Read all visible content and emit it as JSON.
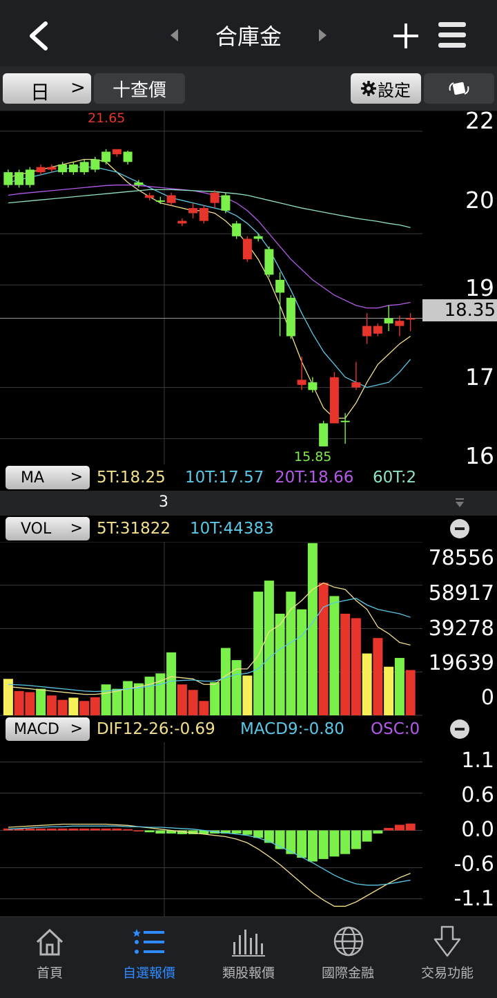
{
  "header": {
    "title": "合庫金",
    "back_icon": "chevron-left-icon",
    "prev_icon": "triangle-left-icon",
    "next_icon": "triangle-right-icon",
    "add_icon": "plus-icon",
    "menu_icon": "hamburger-icon"
  },
  "toolbar": {
    "period_label": "日",
    "period_arrow": ">",
    "query_label": "十查價",
    "settings_label": "設定",
    "settings_icon": "gear-icon",
    "rotate_icon": "rotate-screen-icon"
  },
  "price_chart": {
    "y_ticks": [
      "22",
      "20",
      "19",
      "17",
      "16"
    ],
    "current_price": "18.35",
    "high_label": "21.65",
    "low_label": "15.85",
    "colors": {
      "up": "#e8352b",
      "down": "#7cf04a",
      "ma5": "#f2e08a",
      "ma10": "#5bc8e8",
      "ma20": "#b45ae8",
      "ma60": "#8fe3c0",
      "ma120": "#e86a6a"
    }
  },
  "ma_bar": {
    "label": "MA",
    "ma5": "5T:18.25",
    "ma10": "10T:17.57",
    "ma20": "20T:18.66",
    "ma60": "60T:2"
  },
  "divider": {
    "label": "3"
  },
  "vol_bar": {
    "label": "VOL",
    "ma5": "5T:31822",
    "ma10": "10T:44383"
  },
  "vol_chart": {
    "y_ticks": [
      "78556",
      "58917",
      "39278",
      "19639",
      "0"
    ]
  },
  "macd_bar": {
    "label": "MACD",
    "dif": "DIF12-26:-0.69",
    "macd": "MACD9:-0.80",
    "osc": "OSC:0"
  },
  "macd_chart": {
    "y_ticks": [
      "1.1",
      "0.6",
      "0.0",
      "-0.6",
      "-1.1"
    ]
  },
  "nav": [
    {
      "label": "首頁",
      "icon": "home-icon",
      "active": false
    },
    {
      "label": "自選報價",
      "icon": "list-star-icon",
      "active": true
    },
    {
      "label": "類股報價",
      "icon": "bar-chart-icon",
      "active": false
    },
    {
      "label": "國際金融",
      "icon": "globe-icon",
      "active": false
    },
    {
      "label": "交易功能",
      "icon": "arrow-down-box-icon",
      "active": false
    }
  ],
  "chart_data": [
    {
      "type": "candlestick",
      "title": "合庫金",
      "y_axis_ticks": [
        22,
        20,
        19,
        17,
        16
      ],
      "ylim": [
        15.7,
        22.2
      ],
      "current_price": 18.35,
      "candles": [
        {
          "o": 21.2,
          "c": 20.95,
          "h": 21.25,
          "l": 20.9
        },
        {
          "o": 21.2,
          "c": 20.95,
          "h": 21.25,
          "l": 20.9
        },
        {
          "o": 21.25,
          "c": 20.95,
          "h": 21.3,
          "l": 20.9
        },
        {
          "o": 21.2,
          "c": 21.3,
          "h": 21.35,
          "l": 21.15
        },
        {
          "o": 21.25,
          "c": 21.3,
          "h": 21.35,
          "l": 21.2
        },
        {
          "o": 21.35,
          "c": 21.2,
          "h": 21.4,
          "l": 21.15
        },
        {
          "o": 21.35,
          "c": 21.2,
          "h": 21.4,
          "l": 21.15
        },
        {
          "o": 21.4,
          "c": 21.2,
          "h": 21.45,
          "l": 21.15
        },
        {
          "o": 21.45,
          "c": 21.25,
          "h": 21.5,
          "l": 21.2
        },
        {
          "o": 21.6,
          "c": 21.4,
          "h": 21.65,
          "l": 21.35
        },
        {
          "o": 21.55,
          "c": 21.65,
          "h": 21.65,
          "l": 21.5
        },
        {
          "o": 21.6,
          "c": 21.4,
          "h": 21.62,
          "l": 21.35
        },
        {
          "o": 21.0,
          "c": 20.95,
          "h": 21.05,
          "l": 20.9
        },
        {
          "o": 20.7,
          "c": 20.75,
          "h": 20.8,
          "l": 20.65
        },
        {
          "o": 20.65,
          "c": 20.63,
          "h": 20.72,
          "l": 20.58
        },
        {
          "o": 20.6,
          "c": 20.75,
          "h": 20.8,
          "l": 20.55
        },
        {
          "o": 20.2,
          "c": 20.25,
          "h": 20.3,
          "l": 20.15
        },
        {
          "o": 20.4,
          "c": 20.5,
          "h": 20.6,
          "l": 20.3
        },
        {
          "o": 20.25,
          "c": 20.5,
          "h": 20.55,
          "l": 20.2
        },
        {
          "o": 20.6,
          "c": 20.8,
          "h": 20.85,
          "l": 20.5
        },
        {
          "o": 20.75,
          "c": 20.45,
          "h": 20.8,
          "l": 20.4
        },
        {
          "o": 20.2,
          "c": 19.95,
          "h": 20.25,
          "l": 19.9
        },
        {
          "o": 19.5,
          "c": 19.9,
          "h": 19.95,
          "l": 19.45
        },
        {
          "o": 19.95,
          "c": 19.9,
          "h": 20.0,
          "l": 19.85
        },
        {
          "o": 19.7,
          "c": 19.2,
          "h": 19.75,
          "l": 19.15
        },
        {
          "o": 19.1,
          "c": 18.85,
          "h": 19.25,
          "l": 18.0
        },
        {
          "o": 18.75,
          "c": 18.0,
          "h": 18.8,
          "l": 17.95
        },
        {
          "o": 17.05,
          "c": 17.15,
          "h": 17.6,
          "l": 16.95
        },
        {
          "o": 17.1,
          "c": 16.95,
          "h": 17.2,
          "l": 16.9
        },
        {
          "o": 16.3,
          "c": 15.85,
          "h": 16.35,
          "l": 15.85
        },
        {
          "o": 16.3,
          "c": 17.2,
          "h": 17.3,
          "l": 16.3
        },
        {
          "o": 16.35,
          "c": 16.33,
          "h": 16.5,
          "l": 15.9
        },
        {
          "o": 17.0,
          "c": 17.1,
          "h": 17.5,
          "l": 16.95
        },
        {
          "o": 18.0,
          "c": 18.2,
          "h": 18.45,
          "l": 17.85
        },
        {
          "o": 18.05,
          "c": 18.2,
          "h": 18.25,
          "l": 18.0
        },
        {
          "o": 18.35,
          "c": 18.25,
          "h": 18.6,
          "l": 18.1
        },
        {
          "o": 18.2,
          "c": 18.3,
          "h": 18.4,
          "l": 18.0
        },
        {
          "o": 18.35,
          "c": 18.35,
          "h": 18.45,
          "l": 18.1
        }
      ],
      "series": [
        {
          "name": "5T",
          "values": [
            21.1,
            21.15,
            21.2,
            21.25,
            21.3,
            21.35,
            21.4,
            21.45,
            21.45,
            21.4,
            21.2,
            21.0,
            20.85,
            20.72,
            20.6,
            20.55,
            20.5,
            20.45,
            20.45,
            20.4,
            20.25,
            20.05,
            19.8,
            19.5,
            19.1,
            18.6,
            18.05,
            17.5,
            17.05,
            16.6,
            16.4,
            16.4,
            16.7,
            17.1,
            17.45,
            17.65,
            17.85,
            18.0
          ]
        },
        {
          "name": "10T",
          "values": [
            21.0,
            21.05,
            21.1,
            21.15,
            21.2,
            21.25,
            21.3,
            21.3,
            21.3,
            21.25,
            21.2,
            21.1,
            21.0,
            20.9,
            20.8,
            20.7,
            20.65,
            20.6,
            20.55,
            20.5,
            20.45,
            20.35,
            20.2,
            20.0,
            19.7,
            19.3,
            18.9,
            18.45,
            18.05,
            17.7,
            17.45,
            17.2,
            17.1,
            17.0,
            17.05,
            17.1,
            17.3,
            17.55
          ]
        },
        {
          "name": "20T",
          "values": [
            20.75,
            20.78,
            20.8,
            20.82,
            20.84,
            20.86,
            20.88,
            20.9,
            20.92,
            20.94,
            20.95,
            20.95,
            20.94,
            20.92,
            20.9,
            20.88,
            20.86,
            20.84,
            20.8,
            20.75,
            20.7,
            20.6,
            20.45,
            20.25,
            20.0,
            19.75,
            19.5,
            19.3,
            19.1,
            18.95,
            18.8,
            18.7,
            18.6,
            18.55,
            18.55,
            18.6,
            18.62,
            18.66
          ]
        },
        {
          "name": "60T",
          "values": [
            20.6,
            20.62,
            20.64,
            20.66,
            20.68,
            20.7,
            20.72,
            20.74,
            20.76,
            20.78,
            20.8,
            20.82,
            20.84,
            20.86,
            20.86,
            20.86,
            20.85,
            20.84,
            20.83,
            20.82,
            20.8,
            20.78,
            20.75,
            20.7,
            20.65,
            20.6,
            20.55,
            20.5,
            20.46,
            20.42,
            20.38,
            20.34,
            20.3,
            20.27,
            20.24,
            20.2,
            20.17,
            20.12
          ]
        }
      ]
    },
    {
      "type": "bar",
      "title": "VOL",
      "y_axis_ticks": [
        78556,
        58917,
        39278,
        19639,
        0
      ],
      "ylim": [
        0,
        78556
      ],
      "values": [
        16500,
        11000,
        10500,
        12000,
        9000,
        7000,
        8000,
        6500,
        8200,
        14000,
        12000,
        15500,
        14500,
        17500,
        19000,
        28500,
        14000,
        11500,
        6500,
        15000,
        30500,
        25000,
        18000,
        56000,
        61000,
        46000,
        56000,
        48000,
        78000,
        60000,
        54000,
        46000,
        44000,
        28000,
        35000,
        22000,
        26000,
        20500
      ],
      "colors_by_bar": [
        "yellow",
        "red",
        "red",
        "green",
        "red",
        "red",
        "yellow",
        "red",
        "red",
        "green",
        "green",
        "green",
        "green",
        "green",
        "green",
        "green",
        "red",
        "red",
        "red",
        "green",
        "green",
        "green",
        "yellow",
        "green",
        "green",
        "green",
        "green",
        "green",
        "green",
        "red",
        "green",
        "red",
        "red",
        "yellow",
        "red",
        "yellow",
        "green",
        "red"
      ],
      "series": [
        {
          "name": "5T",
          "values": [
            13000,
            12500,
            12000,
            11500,
            11000,
            10500,
            10000,
            9500,
            9500,
            10000,
            11000,
            12000,
            13000,
            14000,
            15500,
            17500,
            17000,
            16500,
            14000,
            14000,
            18000,
            21000,
            21000,
            27000,
            38000,
            41000,
            48000,
            52000,
            57000,
            60000,
            58000,
            57000,
            52000,
            48000,
            40000,
            37000,
            33000,
            31822
          ]
        },
        {
          "name": "10T",
          "values": [
            14000,
            13800,
            13500,
            13000,
            12500,
            12000,
            11500,
            11000,
            10800,
            11000,
            11500,
            12000,
            12500,
            13200,
            14000,
            15500,
            15800,
            16000,
            15500,
            15500,
            17000,
            18500,
            19000,
            21000,
            26000,
            30000,
            33000,
            36000,
            42000,
            49000,
            51000,
            52000,
            53000,
            50000,
            48000,
            47000,
            46000,
            44383
          ]
        }
      ]
    },
    {
      "type": "bar",
      "title": "MACD",
      "y_axis_ticks": [
        1.1,
        0.6,
        0.0,
        -0.6,
        -1.1
      ],
      "ylim": [
        -1.25,
        1.25
      ],
      "osc_values": [
        0.03,
        0.03,
        0.03,
        0.03,
        0.03,
        0.03,
        0.03,
        0.03,
        0.03,
        0.03,
        0.03,
        0.02,
        0.0,
        -0.03,
        -0.05,
        -0.05,
        -0.06,
        -0.06,
        -0.06,
        -0.05,
        -0.05,
        -0.05,
        -0.07,
        -0.12,
        -0.2,
        -0.3,
        -0.38,
        -0.44,
        -0.5,
        -0.46,
        -0.42,
        -0.38,
        -0.3,
        -0.18,
        -0.05,
        0.04,
        0.09,
        0.11
      ],
      "series": [
        {
          "name": "DIF12-26",
          "values": [
            0.05,
            0.06,
            0.07,
            0.08,
            0.09,
            0.1,
            0.1,
            0.1,
            0.1,
            0.1,
            0.09,
            0.08,
            0.06,
            0.04,
            0.02,
            0.0,
            -0.02,
            -0.04,
            -0.06,
            -0.08,
            -0.1,
            -0.14,
            -0.2,
            -0.3,
            -0.42,
            -0.55,
            -0.7,
            -0.85,
            -1.0,
            -1.12,
            -1.22,
            -1.22,
            -1.15,
            -1.05,
            -0.95,
            -0.85,
            -0.76,
            -0.69
          ]
        },
        {
          "name": "MACD9",
          "values": [
            0.02,
            0.03,
            0.04,
            0.05,
            0.06,
            0.06,
            0.07,
            0.07,
            0.07,
            0.07,
            0.07,
            0.06,
            0.06,
            0.05,
            0.05,
            0.04,
            0.03,
            0.02,
            0.0,
            -0.02,
            -0.04,
            -0.06,
            -0.08,
            -0.12,
            -0.18,
            -0.26,
            -0.34,
            -0.43,
            -0.52,
            -0.62,
            -0.72,
            -0.8,
            -0.86,
            -0.88,
            -0.88,
            -0.86,
            -0.83,
            -0.8
          ]
        }
      ]
    }
  ]
}
